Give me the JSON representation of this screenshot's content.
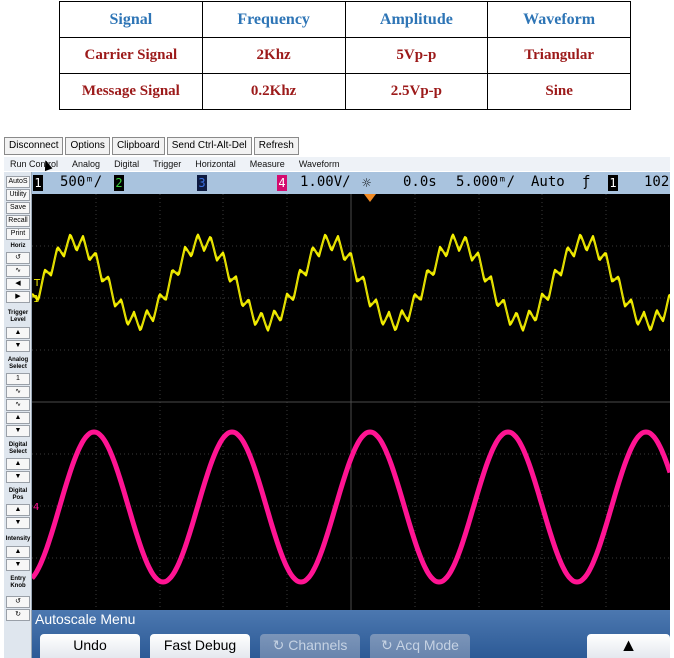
{
  "table": {
    "headers": [
      "Signal",
      "Frequency",
      "Amplitude",
      "Waveform"
    ],
    "rows": [
      [
        "Carrier Signal",
        "2Khz",
        "5Vp-p",
        "Triangular"
      ],
      [
        "Message Signal",
        "0.2Khz",
        "2.5Vp-p",
        "Sine"
      ]
    ]
  },
  "toolbar": [
    "Disconnect",
    "Options",
    "Clipboard",
    "Send Ctrl-Alt-Del",
    "Refresh"
  ],
  "menu": [
    "Run Control",
    "Analog",
    "Digital",
    "Trigger",
    "Horizontal",
    "Measure",
    "Waveform"
  ],
  "status": {
    "ch1": "1",
    "ch1_scale": "500ᵐ/",
    "ch2": "2",
    "ch3": "3",
    "ch4": "4",
    "ch4_scale": "1.00V/",
    "delay": "0.0s",
    "timebase": "5.000ᵐ/",
    "mode": "Auto",
    "trig_ch": "1",
    "trig_level": "102"
  },
  "side": {
    "buttons": [
      "AutoS",
      "Utility",
      "Save",
      "Recall",
      "Print"
    ],
    "labels": [
      "Horiz",
      "Trigger Level",
      "Analog Select",
      "Digital Select",
      "Digital Pos",
      "Intensity",
      "Entry Knob"
    ],
    "analog_select_value": "1"
  },
  "markers": {
    "ch1": "1",
    "trig": "T",
    "ch4": "4"
  },
  "bottom": {
    "title": "Autoscale Menu",
    "keys": [
      "Undo",
      "Fast Debug",
      "Channels",
      "Acq Mode"
    ]
  },
  "colors": {
    "ch1": "#f5f000",
    "ch4": "#ff1493",
    "grid": "#3a3a3a"
  }
}
